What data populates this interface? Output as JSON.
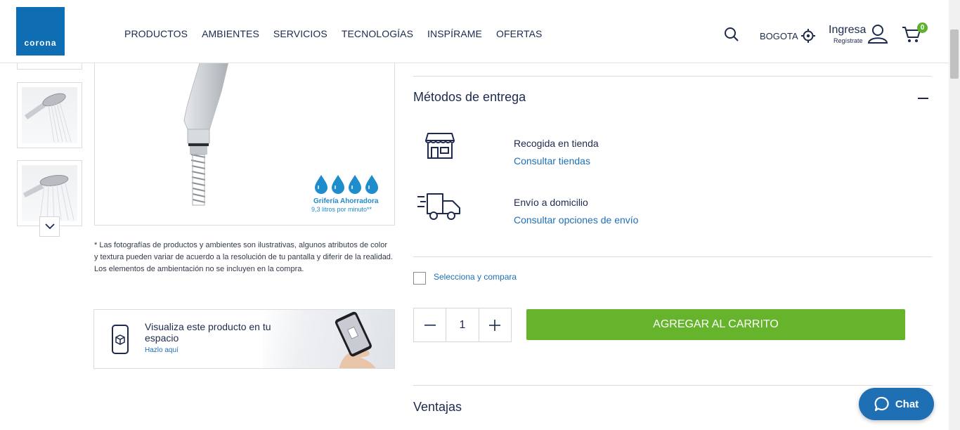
{
  "header": {
    "logo_text": "corona",
    "nav": [
      "PRODUCTOS",
      "AMBIENTES",
      "SERVICIOS",
      "TECNOLOGÍAS",
      "INSPÍRAME",
      "OFERTAS"
    ],
    "city": "BOGOTA",
    "login_main": "Ingresa",
    "login_sub": "Regístrate",
    "cart_count": "0"
  },
  "gallery": {
    "saver_title": "Grifería Ahorradora",
    "saver_sub": "9,3 litros por minuto**",
    "disclaimer": "* Las fotografías de productos y ambientes son ilustrativas, algunos atributos de color y textura pueden variar de acuerdo a la resolución de tu pantalla y diferir de la realidad. Los elementos de ambientación no se incluyen en la compra."
  },
  "ar_banner": {
    "title": "Visualiza este producto en tu espacio",
    "link": "Hazlo aquí"
  },
  "delivery": {
    "title": "Métodos de entrega",
    "options": [
      {
        "title": "Recogida en tienda",
        "link": "Consultar tiendas",
        "icon": "store-icon"
      },
      {
        "title": "Envío a domicilio",
        "link": "Consultar opciones de envío",
        "icon": "delivery-truck-icon"
      }
    ]
  },
  "compare": {
    "label": "Selecciona y compara"
  },
  "purchase": {
    "quantity": "1",
    "add_to_cart": "AGREGAR AL CARRITO"
  },
  "advantages": {
    "title": "Ventajas"
  },
  "chat": {
    "label": "Chat"
  },
  "colors": {
    "brand_blue": "#0f6db3",
    "green": "#66b42c",
    "link": "#1f6fb5",
    "text": "#1d2a4d"
  }
}
